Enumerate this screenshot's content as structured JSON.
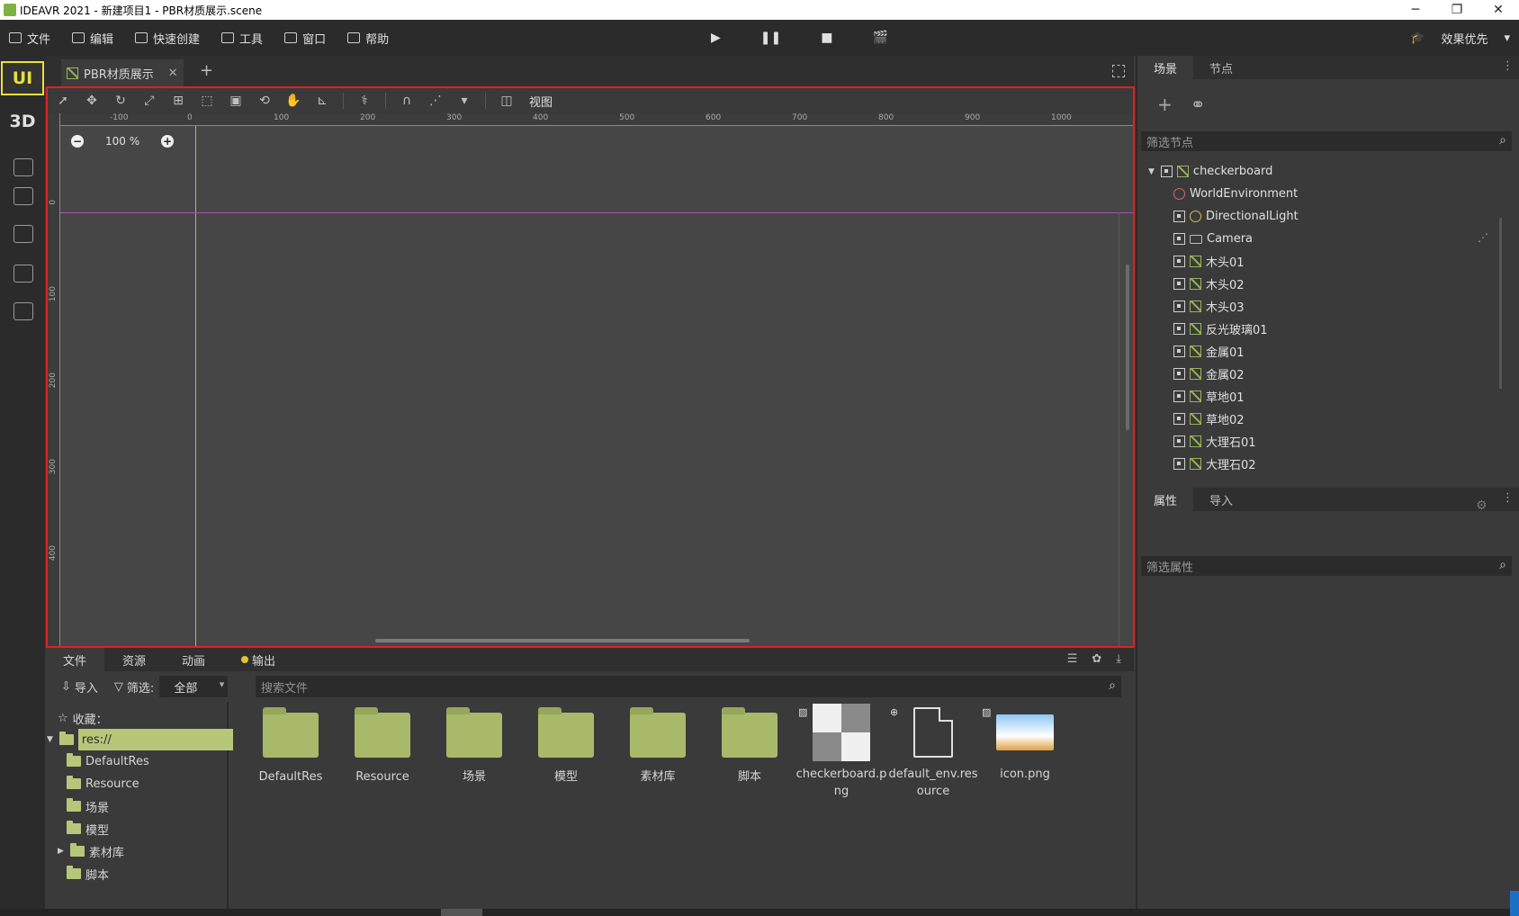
{
  "window": {
    "title": "IDEAVR 2021 - 新建项目1 - PBR材质展示.scene",
    "controls": [
      "─",
      "❐",
      "✕"
    ]
  },
  "menu": {
    "items": [
      "文件",
      "编辑",
      "快速创建",
      "工具",
      "窗口",
      "帮助"
    ],
    "play_controls": [
      "▶",
      "❚❚",
      "■",
      "🎬"
    ],
    "right_label": "效果优先"
  },
  "left_bar": {
    "ui_mode": "UI",
    "mode_3d": "3D"
  },
  "document": {
    "tab_label": "PBR材质展示",
    "tab_close": "✕",
    "tab_add": "+"
  },
  "viewport": {
    "view_label": "视图",
    "zoom_minus": "−",
    "zoom_value": "100 %",
    "zoom_plus": "+",
    "ruler_top_ticks": [
      "-100",
      "0",
      "100",
      "200",
      "300",
      "400",
      "500",
      "600",
      "700",
      "800",
      "900",
      "1000"
    ],
    "ruler_left_ticks": [
      "0",
      "100",
      "200",
      "300",
      "400"
    ]
  },
  "bottom_panel": {
    "tabs": [
      "文件",
      "资源",
      "动画",
      "输出"
    ],
    "import_label": "导入",
    "filter_label": "筛选:",
    "filter_value": "全部",
    "search_placeholder": "搜索文件",
    "favorites_label": "收藏：",
    "tree": {
      "root": "res://",
      "children": [
        "DefaultRes",
        "Resource",
        "场景",
        "模型",
        "素材库",
        "脚本"
      ]
    },
    "files": [
      {
        "name": "DefaultRes",
        "kind": "folder"
      },
      {
        "name": "Resource",
        "kind": "folder"
      },
      {
        "name": "场景",
        "kind": "folder"
      },
      {
        "name": "模型",
        "kind": "folder"
      },
      {
        "name": "素材库",
        "kind": "folder"
      },
      {
        "name": "脚本",
        "kind": "folder"
      },
      {
        "name_line1": "checkerboard.p",
        "name_line2": "ng",
        "kind": "image"
      },
      {
        "name_line1": "default_env.res",
        "name_line2": "ource",
        "kind": "resource"
      },
      {
        "name": "icon.png",
        "kind": "image"
      }
    ]
  },
  "scene_panel": {
    "tabs": [
      "场景",
      "节点"
    ],
    "filter_placeholder": "筛选节点",
    "nodes": [
      "checkerboard",
      "WorldEnvironment",
      "DirectionalLight",
      "Camera",
      "木头01",
      "木头02",
      "木头03",
      "反光玻璃01",
      "金属01",
      "金属02",
      "草地01",
      "草地02",
      "大理石01",
      "大理石02"
    ]
  },
  "inspector_panel": {
    "tabs": [
      "属性",
      "导入"
    ],
    "filter_placeholder": "筛选属性"
  },
  "colors": {
    "accent_ui_mode": "#e6e23b",
    "viewport_border": "#e02020",
    "folder": "#a9b96a",
    "selected_tree": "#b7c77a",
    "output_dot": "#e6c229"
  }
}
